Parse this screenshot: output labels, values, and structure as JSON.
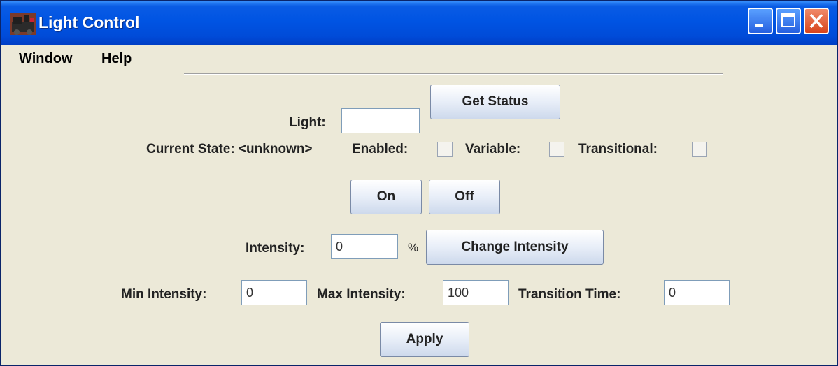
{
  "window": {
    "title": "Light Control"
  },
  "menu": {
    "items": [
      "Window",
      "Help"
    ]
  },
  "light": {
    "label": "Light:",
    "value": "",
    "get_status_label": "Get Status"
  },
  "state": {
    "current_state_text": "Current State: <unknown>",
    "enabled_label": "Enabled:",
    "enabled_checked": false,
    "variable_label": "Variable:",
    "variable_checked": false,
    "transitional_label": "Transitional:",
    "transitional_checked": false
  },
  "power": {
    "on_label": "On",
    "off_label": "Off"
  },
  "intensity": {
    "label": "Intensity:",
    "value": "0",
    "unit": "%",
    "change_label": "Change Intensity"
  },
  "limits": {
    "min_label": "Min Intensity:",
    "min_value": "0",
    "max_label": "Max Intensity:",
    "max_value": "100",
    "transition_label": "Transition Time:",
    "transition_value": "0"
  },
  "apply_label": "Apply",
  "icons": {
    "app": "train-icon",
    "minimize": "minimize-icon",
    "maximize": "maximize-icon",
    "close": "close-icon"
  }
}
